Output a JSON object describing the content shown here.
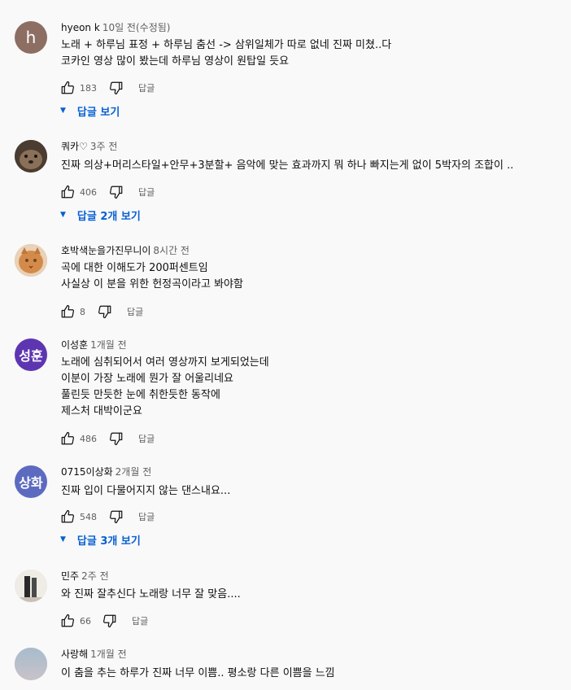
{
  "comments": [
    {
      "author": "hyeon k",
      "time": "10일 전(수정됨)",
      "avatar": {
        "letter": "h",
        "color": "#8d6e63"
      },
      "lines": [
        "노래 + 하루님 표정 + 하루님 춤선 -> 삼위일체가 따로 없네 진짜 미쳤..다",
        "코카인 영상 많이 봤는데 하루님 영상이 원탑일 듯요"
      ],
      "likes": "183",
      "reply_label": "답글",
      "replies_label": "답글 보기"
    },
    {
      "author": "쿼카♡",
      "time": "3주 전",
      "avatar": {
        "letter": "",
        "color": "#6b5a4a"
      },
      "lines": [
        "진짜 의상+머리스타일+안무+3분할+ 음악에 맞는 효과까지 뭐 하나 빠지는게 없이 5박자의 조합이 .."
      ],
      "likes": "406",
      "reply_label": "답글",
      "replies_label": "답글 2개 보기"
    },
    {
      "author": "호박색눈을가진무니이",
      "time": "8시간 전",
      "avatar": {
        "letter": "",
        "color": "#d9a06b"
      },
      "lines": [
        "곡에 대한 이해도가 200퍼센트임",
        "사실상 이 분을 위한 헌정곡이라고 봐야함"
      ],
      "likes": "8",
      "reply_label": "답글",
      "replies_label": ""
    },
    {
      "author": "이성훈",
      "time": "1개월 전",
      "avatar": {
        "letter": "성훈",
        "color": "#5e35b1"
      },
      "lines": [
        "노래에 심취되어서 여러 영상까지 보게되었는데",
        "이분이 가장 노래에 뭔가 잘 어울리네요",
        "풀린듯 만듯한 눈에 취한듯한 동작에",
        "제스처 대박이군요"
      ],
      "likes": "486",
      "reply_label": "답글",
      "replies_label": ""
    },
    {
      "author": "0715이상화",
      "time": "2개월 전",
      "avatar": {
        "letter": "상화",
        "color": "#5c6bc0"
      },
      "lines": [
        "진짜 입이 다물어지지 않는 댄스내요..."
      ],
      "likes": "548",
      "reply_label": "답글",
      "replies_label": "답글 3개 보기"
    },
    {
      "author": "민주",
      "time": "2주 전",
      "avatar": {
        "letter": "",
        "color": "#e8e4dc"
      },
      "lines": [
        "와 진짜 잘추신다 노래랑 너무 잘 맞음...."
      ],
      "likes": "66",
      "reply_label": "답글",
      "replies_label": ""
    },
    {
      "author": "사랑해",
      "time": "1개월 전",
      "avatar": {
        "letter": "",
        "color": "#9fb6c8"
      },
      "lines": [
        "이 춤을 추는 하루가 진짜 너무 이쁨.. 평소랑 다른 이쁨을 느낌"
      ],
      "likes": "",
      "reply_label": "",
      "replies_label": ""
    }
  ]
}
